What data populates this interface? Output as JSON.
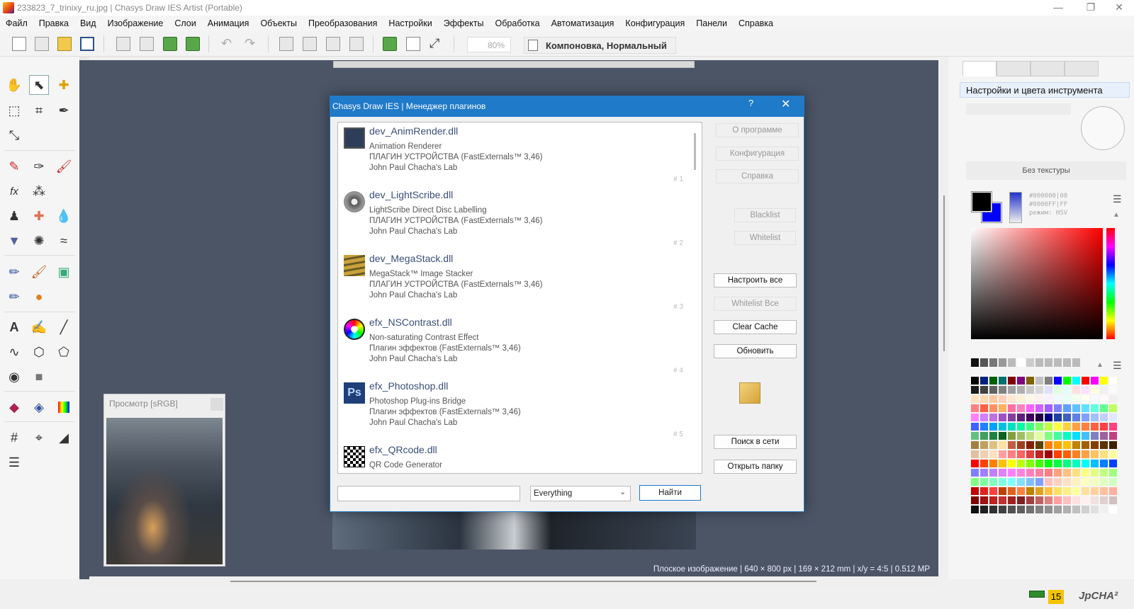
{
  "window": {
    "title": "233823_7_trinixy_ru.jpg | Chasys Draw IES Artist (Portable)",
    "minimize": "—",
    "maximize": "❐",
    "close": "✕"
  },
  "menu": [
    "Файл",
    "Правка",
    "Вид",
    "Изображение",
    "Слои",
    "Анимация",
    "Объекты",
    "Преобразования",
    "Настройки",
    "Эффекты",
    "Обработка",
    "Автоматизация",
    "Конфигурация",
    "Панели",
    "Справка"
  ],
  "toolbar": {
    "zoom": "80%",
    "layer_mode": "Компоновка, Нормальный"
  },
  "canvas": {
    "status": "Плоское изображение | 640 × 800 px | 169 × 212 mm | x/y = 4:5 | 0.512 MP"
  },
  "preview": {
    "title": "Просмотр [sRGB]"
  },
  "dialog": {
    "title": "Chasys Draw IES | Менеджер плагинов",
    "help": "?",
    "close": "✕",
    "plugins": [
      {
        "name": "dev_AnimRender.dll",
        "lines": [
          "Animation Renderer",
          "ПЛАГИН УСТРОЙСТВА (FastExternals™ 3,46)",
          "John Paul Chacha's Lab"
        ],
        "num": "# 1"
      },
      {
        "name": "dev_LightScribe.dll",
        "lines": [
          "LightScribe Direct Disc Labelling",
          "ПЛАГИН УСТРОЙСТВА (FastExternals™ 3,46)",
          "John Paul Chacha's Lab"
        ],
        "num": "# 2"
      },
      {
        "name": "dev_MegaStack.dll",
        "lines": [
          "MegaStack™ Image Stacker",
          "ПЛАГИН УСТРОЙСТВА (FastExternals™ 3,46)",
          "John Paul Chacha's Lab"
        ],
        "num": "# 3"
      },
      {
        "name": "efx_NSContrast.dll",
        "lines": [
          "Non-saturating Contrast Effect",
          "Плагин эффектов (FastExternals™ 3,46)",
          "John Paul Chacha's Lab"
        ],
        "num": "# 4"
      },
      {
        "name": "efx_Photoshop.dll",
        "lines": [
          "Photoshop Plug-ins Bridge",
          "Плагин эффектов (FastExternals™ 3,46)",
          "John Paul Chacha's Lab"
        ],
        "num": "# 5"
      },
      {
        "name": "efx_QRcode.dll",
        "lines": [
          "QR Code Generator"
        ],
        "num": ""
      }
    ],
    "buttons": {
      "about": "О программе",
      "configure": "Конфигурация",
      "help": "Справка",
      "blacklist": "Blacklist",
      "whitelist": "Whitelist",
      "configure_all": "Настроить все",
      "whitelist_all": "Whitelist Все",
      "clear_cache": "Clear Cache",
      "refresh": "Обновить",
      "search_web": "Поиск в сети",
      "open_folder": "Открыть папку"
    },
    "search_value": "",
    "filter": "Everything",
    "find": "Найти"
  },
  "right_panel": {
    "header": "Настройки и цвета инструмента",
    "texture": "Без текстуры",
    "color_values": [
      "#000000|00",
      "#0000FF|FF",
      "режим: HSV"
    ],
    "fg_color": "#000000",
    "bg_color": "#0000FF"
  },
  "status": {
    "warnings": "15",
    "brand": "JpCHA²"
  }
}
